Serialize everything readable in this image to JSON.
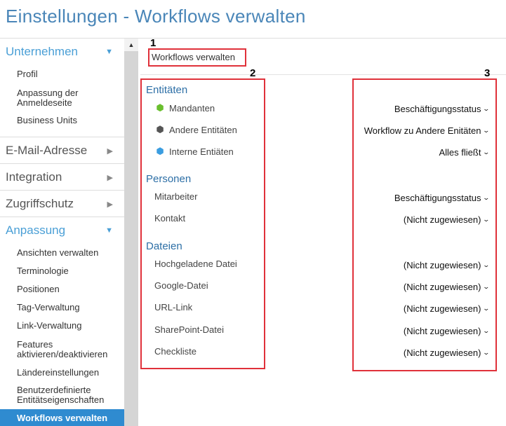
{
  "page_title": "Einstellungen - Workflows verwalten",
  "breadcrumb": "Workflows verwalten",
  "annotations": [
    "1",
    "2",
    "3"
  ],
  "colors": {
    "accent": "#4a9fd6",
    "active_bg": "#2f8bd0",
    "annotation_red": "#e0313a",
    "category_blue": "#2d6fa6"
  },
  "sidebar": {
    "scroll_up_icon": "triangle-up",
    "sections": [
      {
        "label": "Unternehmen",
        "state": "expanded",
        "items": [
          "Profil",
          "Anpassung der Anmeldeseite",
          "Business Units"
        ]
      },
      {
        "label": "E-Mail-Adresse",
        "state": "collapsed"
      },
      {
        "label": "Integration",
        "state": "collapsed"
      },
      {
        "label": "Zugriffschutz",
        "state": "collapsed"
      },
      {
        "label": "Anpassung",
        "state": "expanded",
        "items": [
          "Ansichten verwalten",
          "Terminologie",
          "Positionen",
          "Tag-Verwaltung",
          "Link-Verwaltung",
          "Features aktivieren/deaktivieren",
          "Ländereinstellungen",
          "Benutzerdefinierte Entitätseigenschaften",
          "Workflows verwalten"
        ],
        "active_item": "Workflows verwalten"
      }
    ]
  },
  "categories": [
    {
      "label": "Entitäten",
      "rows": [
        {
          "label": "Mandanten",
          "icon": "hexagon-green-icon",
          "icon_color": "#6abf2e",
          "workflow": "Beschäftigungsstatus"
        },
        {
          "label": "Andere Entitäten",
          "icon": "hexagon-dark-icon",
          "icon_color": "#555555",
          "workflow": "Workflow zu Andere Enitäten"
        },
        {
          "label": "Interne Entiäten",
          "icon": "hexagon-blue-icon",
          "icon_color": "#3a9de0",
          "workflow": "Alles fließt"
        }
      ]
    },
    {
      "label": "Personen",
      "rows": [
        {
          "label": "Mitarbeiter",
          "workflow": "Beschäftigungsstatus"
        },
        {
          "label": "Kontakt",
          "workflow": "(Nicht zugewiesen)"
        }
      ]
    },
    {
      "label": "Dateien",
      "rows": [
        {
          "label": "Hochgeladene Datei",
          "workflow": "(Nicht zugewiesen)"
        },
        {
          "label": "Google-Datei",
          "workflow": "(Nicht zugewiesen)"
        },
        {
          "label": "URL-Link",
          "workflow": "(Nicht zugewiesen)"
        },
        {
          "label": "SharePoint-Datei",
          "workflow": "(Nicht zugewiesen)"
        },
        {
          "label": "Checkliste",
          "workflow": "(Nicht zugewiesen)"
        }
      ]
    }
  ]
}
